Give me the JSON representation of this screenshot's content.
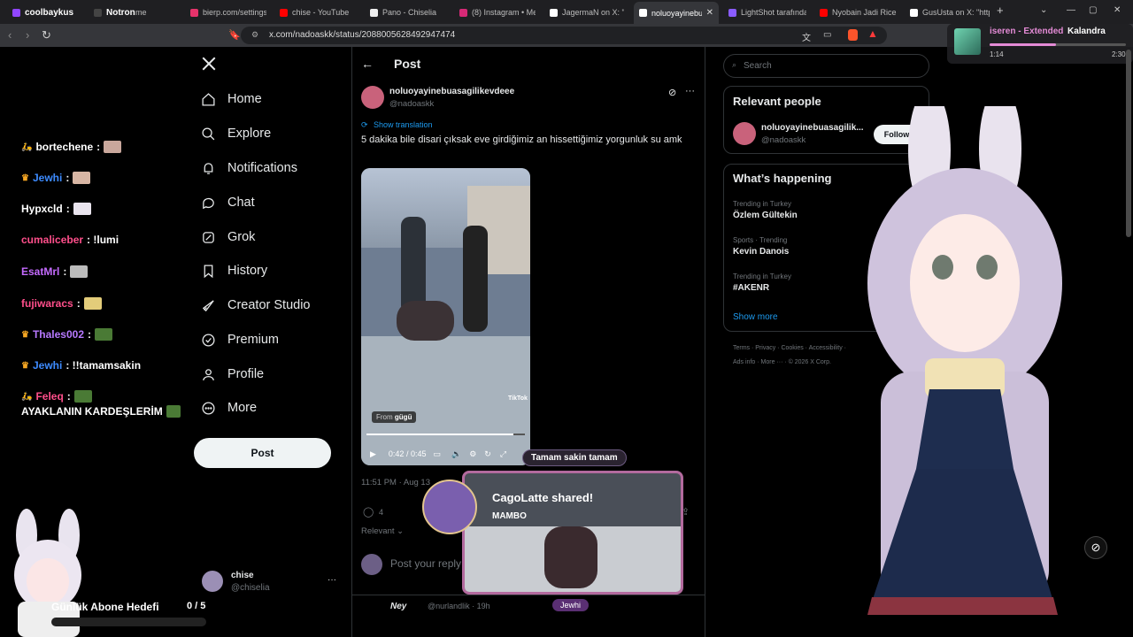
{
  "colors": {
    "accent": "#1d9bf0",
    "background": "#000000",
    "chat_pink": "#ff4f8b",
    "chat_purple": "#b779ff"
  },
  "browser": {
    "tabs": [
      {
        "title": "coolbaykus",
        "icon": "twitch-icon"
      },
      {
        "title": "Notron",
        "icon": "app-icon"
      },
      {
        "title": "me",
        "icon": "page-icon"
      },
      {
        "title": "bierp.com/settings",
        "icon": "bierp-icon"
      },
      {
        "title": "chise - YouTube",
        "icon": "youtube-icon"
      },
      {
        "title": "Pano - Chiselia",
        "icon": "pano-icon"
      },
      {
        "title": "(8) Instagram • Me",
        "icon": "instagram-icon"
      },
      {
        "title": "JagermaN on X: \"O",
        "icon": "x-icon"
      },
      {
        "title": "noluoyayinebu",
        "icon": "x-icon"
      },
      {
        "title": "LightShot tarafında",
        "icon": "lightshot-icon"
      },
      {
        "title": "Nyobain Jadi Rice",
        "icon": "youtube-icon"
      },
      {
        "title": "GusUsta on X: \"http",
        "icon": "x-icon"
      }
    ],
    "url": "x.com/nadoaskk/status/2088005628492947474"
  },
  "music_widget": {
    "title": "iseren - Extended",
    "artist": "Kalandra",
    "elapsed": "1:14",
    "duration": "2:30",
    "progress": 0.49
  },
  "stream_chat": [
    {
      "user": "bortechene",
      "message": ":",
      "color": "#ffffff",
      "badge": "scooter-icon"
    },
    {
      "user": "Jewhi",
      "message": ":",
      "color": "#3d8bff",
      "badge": "crown-icon"
    },
    {
      "user": "Hypxcld",
      "message": ":",
      "color": "#ffffff",
      "badge": ""
    },
    {
      "user": "cumaliceber",
      "message": ": !lumi",
      "color": "#ff4f8b",
      "badge": ""
    },
    {
      "user": "EsatMrl",
      "message": ":",
      "color": "#c56bff",
      "badge": ""
    },
    {
      "user": "fujiwaracs",
      "message": ":",
      "color": "#ff4f8b",
      "badge": ""
    },
    {
      "user": "Thales002",
      "message": ":",
      "color": "#b779ff",
      "badge": "crown-icon"
    },
    {
      "user": "Jewhi",
      "message": ": !!tamamsakin",
      "color": "#3d8bff",
      "badge": "crown-icon"
    },
    {
      "user": "Feleq",
      "message": ":",
      "color": "#ff4f8b",
      "badge": "scooter-icon"
    }
  ],
  "chat_extra_line": "AYAKLANIN KARDEŞLERİM",
  "sub_goal": {
    "label": "Günlük Abone Hedefi",
    "value": "0 / 5",
    "progress": 0
  },
  "x_sidebar": {
    "nav": [
      "Home",
      "Explore",
      "Notifications",
      "Chat",
      "Grok",
      "History",
      "Creator Studio",
      "Premium",
      "Profile",
      "More"
    ],
    "post_button": "Post",
    "account_name": "chise",
    "account_handle": "@chiselia"
  },
  "post": {
    "header": "Post",
    "author_name": "noluoyayinebuasagilikevdeee",
    "author_handle": "@nadoaskk",
    "show_translation": "Show translation",
    "text": "5 dakika bile disari çıksak eve girdiğimiz an hissettiğimiz yorgunluk su amk",
    "video_from_label": "From",
    "video_from_name": "gügü",
    "video_time": "0:42 / 0:45",
    "video_progress": 0.93,
    "timestamp": "11:51 PM · Aug 13",
    "reply_count": "4",
    "relevant_label": "Relevant",
    "reply_placeholder": "Post your reply",
    "next_reply_author": "Ney",
    "next_reply_handle": "@nurlandlik · 19h"
  },
  "right_column": {
    "search_placeholder": "Search",
    "relevant_title": "Relevant people",
    "relevant_name": "noluoyayinebuasagilik...",
    "relevant_handle": "@nadoaskk",
    "follow_label": "Follow",
    "happening_title": "What’s happening",
    "trends": [
      {
        "context": "Trending in Turkey",
        "topic": "Özlem Gültekin"
      },
      {
        "context": "Sports · Trending",
        "topic": "Kevin Danois"
      },
      {
        "context": "Trending in Turkey",
        "topic": "#AKENR"
      }
    ],
    "show_more": "Show more",
    "footer_line1": "Terms · Privacy · Cookies · Accessibility ·",
    "footer_line2": "Ads info · More ··· · © 2026 X Corp."
  },
  "overlays": {
    "chat_bubble": "Tamam sakin tamam",
    "alert_title": "CagoLatte shared!",
    "alert_sub": "MAMBO",
    "name_tag": "Jewhi"
  }
}
